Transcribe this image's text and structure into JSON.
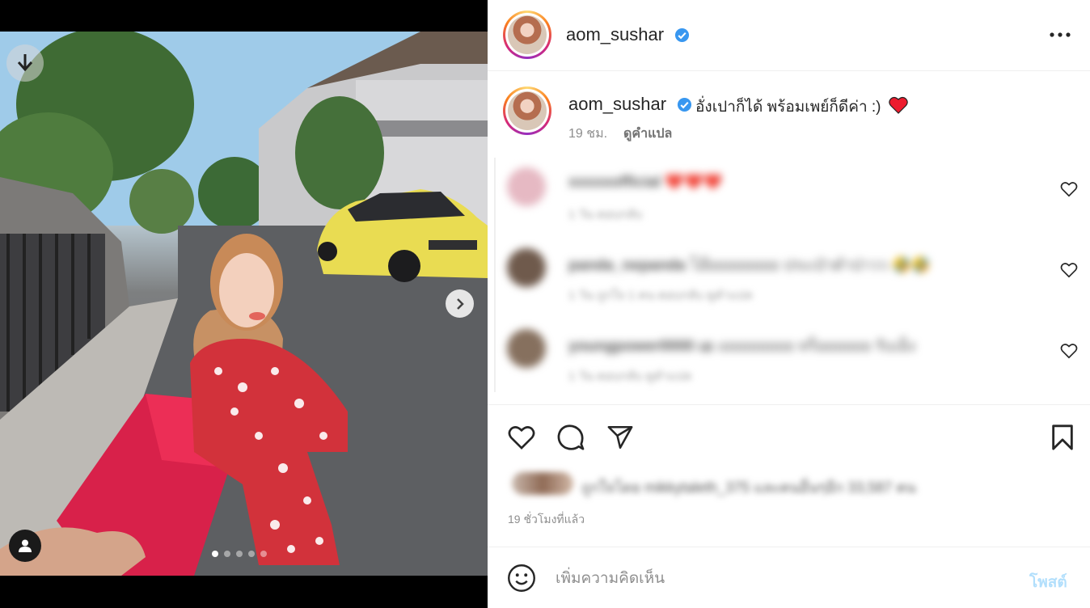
{
  "post": {
    "author": "aom_sushar",
    "verified": true,
    "caption": "อั่งเปาก็ได้ พร้อมเพย์ก็ดีค่า :)",
    "caption_emoji": "red-heart",
    "caption_age": "19 ชม.",
    "translate_label": "ดูคำแปล",
    "posted_ago": "19 ชั่วโมงที่แล้ว",
    "carousel": {
      "total": 5,
      "current": 1
    }
  },
  "comments": [
    {
      "user": "xxxxxofficial",
      "text": "❤️❤️❤️",
      "meta": "1 วัน   ตอบกลับ",
      "avatar_color": "#e6b9c3"
    },
    {
      "user": "panda_nepanda",
      "text": "โอ๊ยยยยยยยย ประเป๋าดำป่าวว 🤣🤣",
      "meta": "1 วัน   ถูกใจ 1 คน   ตอบกลับ   ดูคำแปล",
      "avatar_color": "#6f5a4c"
    },
    {
      "user": "youngpower0000 เอ",
      "text": "เยยยยยยยย ทร็อยยยยย รับเอ็ง",
      "meta": "1 วัน   ตอบกลับ   ดูคำแปล",
      "avatar_color": "#86705e"
    }
  ],
  "likes_summary": "ถูกใจโดย mikkytaleth_375 และคนอื่นๆอีก 33,587 คน",
  "composer": {
    "placeholder": "เพิ่มความคิดเห็น",
    "post_label": "โพสต์"
  },
  "colors": {
    "verified": "#3897f0",
    "heart": "#ed4956",
    "post_button_disabled": "#b2dffc",
    "muted_text": "#8e8e8e"
  },
  "icons": {
    "header": [
      "more-options-icon"
    ],
    "actions": [
      "heart-icon",
      "comment-icon",
      "share-icon",
      "bookmark-icon"
    ],
    "media": [
      "download-icon",
      "chevron-right-icon",
      "user-tag-icon"
    ],
    "composer": [
      "emoji-icon"
    ]
  }
}
